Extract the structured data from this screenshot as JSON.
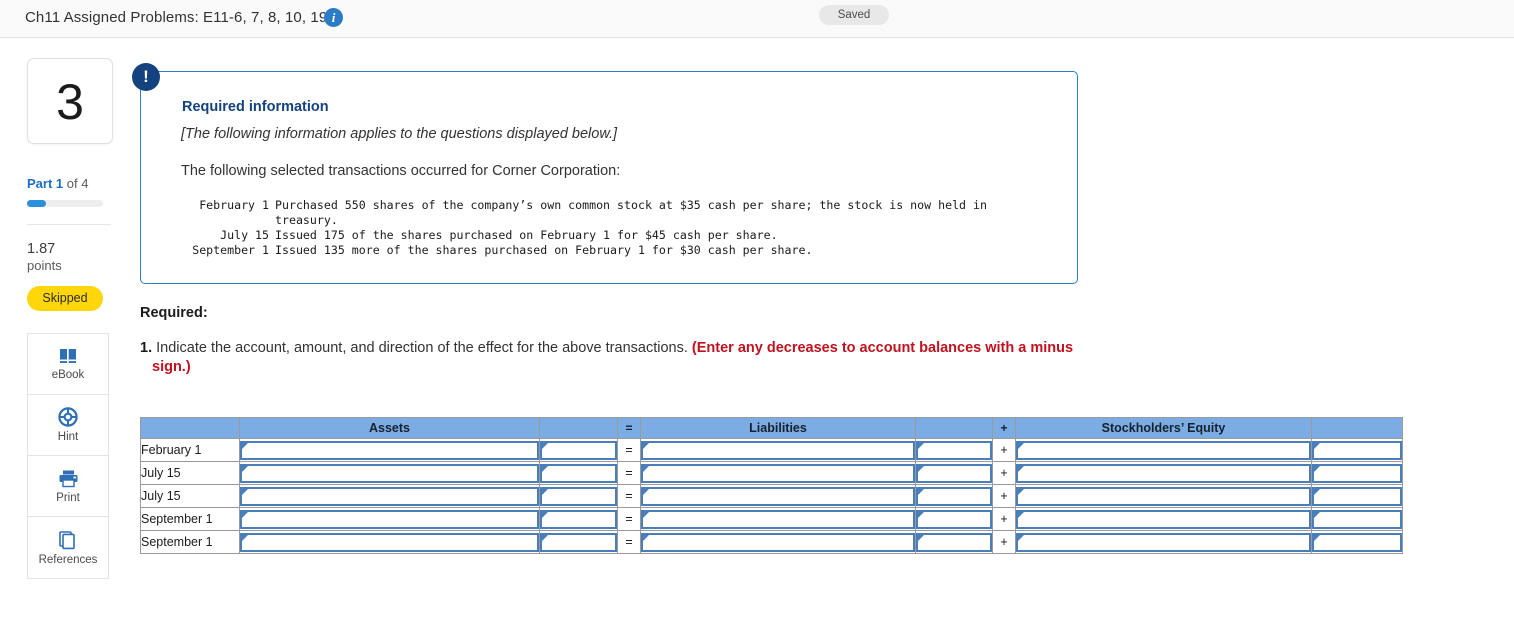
{
  "topbar": {
    "title": "Ch11 Assigned Problems: E11-6, 7, 8, 10, 19",
    "info_icon": "info-icon",
    "saved_label": "Saved"
  },
  "rail": {
    "question_number": "3",
    "part_prefix": "Part 1",
    "part_suffix": " of 4",
    "progress_percent": 25,
    "points_value": "1.87",
    "points_label": "points",
    "status_badge": "Skipped",
    "tools": [
      {
        "label": "eBook",
        "icon": "book-icon"
      },
      {
        "label": "Hint",
        "icon": "life-preserver-icon"
      },
      {
        "label": "Print",
        "icon": "printer-icon"
      },
      {
        "label": "References",
        "icon": "stacked-pages-icon"
      }
    ]
  },
  "callout": {
    "alert_icon": "exclamation-icon",
    "heading": "Required information",
    "italic_note": "[The following information applies to the questions displayed below.]",
    "lead": "The following selected transactions occurred for Corner Corporation:",
    "transactions": [
      {
        "date": "February 1",
        "description": "Purchased 550 shares of the company’s own common stock at $35 cash per share; the stock is now held in",
        "continuation": "treasury."
      },
      {
        "date": "July 15",
        "description": "Issued 175 of the shares purchased on February 1 for $45 cash per share.",
        "continuation": ""
      },
      {
        "date": "September 1",
        "description": "Issued 135 more of the shares purchased on February 1 for $30 cash per share.",
        "continuation": ""
      }
    ]
  },
  "required": {
    "heading": "Required:",
    "item_number": "1.",
    "item_text": "Indicate the account, amount, and direction of the effect for the above transactions.",
    "item_warning": "(Enter any decreases to account balances with a minus sign.)"
  },
  "table": {
    "headers": {
      "date_col": "",
      "assets": "Assets",
      "assets_amount": "",
      "equals": "=",
      "liabilities": "Liabilities",
      "liabilities_amount": "",
      "plus": "+",
      "equity": "Stockholders’ Equity",
      "equity_amount": ""
    },
    "rows": [
      {
        "date": "February 1",
        "assets_account": "",
        "assets_amount": "",
        "eq": "=",
        "liab_account": "",
        "liab_amount": "",
        "plus": "+",
        "eq_account": "",
        "eq_amount": ""
      },
      {
        "date": "July 15",
        "assets_account": "",
        "assets_amount": "",
        "eq": "=",
        "liab_account": "",
        "liab_amount": "",
        "plus": "+",
        "eq_account": "",
        "eq_amount": ""
      },
      {
        "date": "July 15",
        "assets_account": "",
        "assets_amount": "",
        "eq": "=",
        "liab_account": "",
        "liab_amount": "",
        "plus": "+",
        "eq_account": "",
        "eq_amount": ""
      },
      {
        "date": "September 1",
        "assets_account": "",
        "assets_amount": "",
        "eq": "=",
        "liab_account": "",
        "liab_amount": "",
        "plus": "+",
        "eq_account": "",
        "eq_amount": ""
      },
      {
        "date": "September 1",
        "assets_account": "",
        "assets_amount": "",
        "eq": "=",
        "liab_account": "",
        "liab_amount": "",
        "plus": "+",
        "eq_account": "",
        "eq_amount": ""
      }
    ]
  },
  "colors": {
    "accent_blue": "#2b7cc4",
    "navy": "#13427e",
    "table_header_blue": "#7bace4",
    "input_border_blue": "#4a7ebb",
    "warning_red": "#c1121f",
    "badge_yellow": "#ffd60a"
  }
}
